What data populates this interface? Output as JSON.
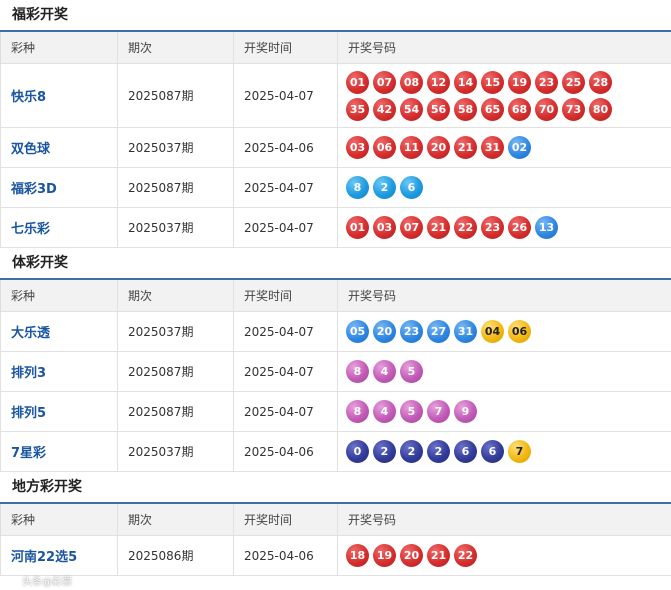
{
  "sections": [
    {
      "title": "福彩开奖",
      "headers": [
        "彩种",
        "期次",
        "开奖时间",
        "开奖号码"
      ],
      "rows": [
        {
          "name": "快乐8",
          "period": "2025087期",
          "date": "2025-04-07",
          "height": 64,
          "balls": [
            [
              "01",
              "red"
            ],
            [
              "07",
              "red"
            ],
            [
              "08",
              "red"
            ],
            [
              "12",
              "red"
            ],
            [
              "14",
              "red"
            ],
            [
              "15",
              "red"
            ],
            [
              "19",
              "red"
            ],
            [
              "23",
              "red"
            ],
            [
              "25",
              "red"
            ],
            [
              "28",
              "red"
            ],
            [
              "35",
              "red"
            ],
            [
              "42",
              "red"
            ],
            [
              "54",
              "red"
            ],
            [
              "56",
              "red"
            ],
            [
              "58",
              "red"
            ],
            [
              "65",
              "red"
            ],
            [
              "68",
              "red"
            ],
            [
              "70",
              "red"
            ],
            [
              "73",
              "red"
            ],
            [
              "80",
              "red"
            ]
          ]
        },
        {
          "name": "双色球",
          "period": "2025037期",
          "date": "2025-04-06",
          "height": 40,
          "balls": [
            [
              "03",
              "red"
            ],
            [
              "06",
              "red"
            ],
            [
              "11",
              "red"
            ],
            [
              "20",
              "red"
            ],
            [
              "21",
              "red"
            ],
            [
              "31",
              "red"
            ],
            [
              "02",
              "blue"
            ]
          ]
        },
        {
          "name": "福彩3D",
          "period": "2025087期",
          "date": "2025-04-07",
          "height": 40,
          "balls": [
            [
              "8",
              "sky"
            ],
            [
              "2",
              "sky"
            ],
            [
              "6",
              "sky"
            ]
          ]
        },
        {
          "name": "七乐彩",
          "period": "2025037期",
          "date": "2025-04-07",
          "height": 40,
          "balls": [
            [
              "01",
              "red"
            ],
            [
              "03",
              "red"
            ],
            [
              "07",
              "red"
            ],
            [
              "21",
              "red"
            ],
            [
              "22",
              "red"
            ],
            [
              "23",
              "red"
            ],
            [
              "26",
              "red"
            ],
            [
              "13",
              "blue"
            ]
          ]
        }
      ]
    },
    {
      "title": "体彩开奖",
      "headers": [
        "彩种",
        "期次",
        "开奖时间",
        "开奖号码"
      ],
      "rows": [
        {
          "name": "大乐透",
          "period": "2025037期",
          "date": "2025-04-07",
          "height": 40,
          "balls": [
            [
              "05",
              "blue"
            ],
            [
              "20",
              "blue"
            ],
            [
              "23",
              "blue"
            ],
            [
              "27",
              "blue"
            ],
            [
              "31",
              "blue"
            ],
            [
              "04",
              "yellow"
            ],
            [
              "06",
              "yellow"
            ]
          ]
        },
        {
          "name": "排列3",
          "period": "2025087期",
          "date": "2025-04-07",
          "height": 40,
          "balls": [
            [
              "8",
              "purple"
            ],
            [
              "4",
              "purple"
            ],
            [
              "5",
              "purple"
            ]
          ]
        },
        {
          "name": "排列5",
          "period": "2025087期",
          "date": "2025-04-07",
          "height": 40,
          "balls": [
            [
              "8",
              "purple"
            ],
            [
              "4",
              "purple"
            ],
            [
              "5",
              "purple"
            ],
            [
              "7",
              "purple"
            ],
            [
              "9",
              "purple"
            ]
          ]
        },
        {
          "name": "7星彩",
          "period": "2025037期",
          "date": "2025-04-06",
          "height": 40,
          "balls": [
            [
              "0",
              "navy"
            ],
            [
              "2",
              "navy"
            ],
            [
              "2",
              "navy"
            ],
            [
              "2",
              "navy"
            ],
            [
              "6",
              "navy"
            ],
            [
              "6",
              "navy"
            ],
            [
              "7",
              "yellow"
            ]
          ]
        }
      ]
    },
    {
      "title": "地方彩开奖",
      "headers": [
        "彩种",
        "期次",
        "开奖时间",
        "开奖号码"
      ],
      "rows": [
        {
          "name": "河南22选5",
          "period": "2025086期",
          "date": "2025-04-06",
          "height": 40,
          "balls": [
            [
              "18",
              "red"
            ],
            [
              "19",
              "red"
            ],
            [
              "20",
              "red"
            ],
            [
              "21",
              "red"
            ],
            [
              "22",
              "red"
            ]
          ]
        }
      ]
    }
  ],
  "watermark": "头条@彩票",
  "colors": {
    "header_border": "#3f6fa8",
    "name_text": "#1a56a0"
  }
}
